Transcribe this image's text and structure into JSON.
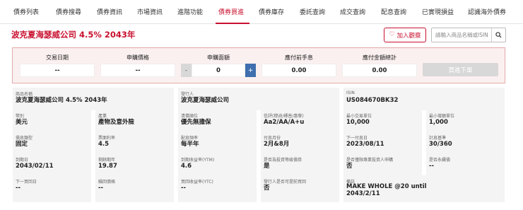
{
  "nav": {
    "items": [
      "債券列表",
      "債券搜尋",
      "債券資訊",
      "市場資訊",
      "進階功能",
      "債券買進",
      "債券庫存",
      "委託查詢",
      "成交查詢",
      "配息查詢",
      "已實現損益",
      "認識海外債券"
    ],
    "active": "債券買進"
  },
  "header": {
    "title": "波克夏海瑟威公司 4.5% 2043年",
    "favorite_label": "加入觀察",
    "search_placeholder": "請輸入商品名稱或ISIN"
  },
  "trade": {
    "trade_date_label": "交易日期",
    "trade_date_value": "--",
    "price_label": "申購價格",
    "price_value": "--",
    "face_label": "申購面額",
    "face_value": "0",
    "minus_label": "-",
    "plus_label": "+",
    "fee_label": "應付前手息",
    "fee_value": "0.00",
    "total_label": "應付金額總計",
    "total_value": "0.00",
    "submit_label": "買進下單"
  },
  "info": {
    "product_name": {
      "label": "商品名稱",
      "value": "波克夏海瑟威公司 4.5% 2043年"
    },
    "issuer": {
      "label": "發行人",
      "value": "波克夏海瑟威公司"
    },
    "isin": {
      "label": "ISIN",
      "value": "US084670BK32"
    },
    "currency": {
      "label": "幣別",
      "value": "美元"
    },
    "industry": {
      "label": "產業",
      "value": "產物及意外險"
    },
    "seniority": {
      "label": "清償順位",
      "value": "優先無擔保"
    },
    "rating": {
      "label": "信評(穆迪/標普/惠譽)",
      "value": "Aa2/AA/A+u"
    },
    "min_unit": {
      "label": "最小交易單位",
      "value": "10,000"
    },
    "min_increment": {
      "label": "最小增額單位",
      "value": "1,000"
    },
    "bond_type": {
      "label": "債息類型",
      "value": "固定"
    },
    "coupon_rate": {
      "label": "票面利率",
      "value": "4.5"
    },
    "pay_freq": {
      "label": "配息頻率",
      "value": "每半年"
    },
    "pay_month": {
      "label": "付息月份",
      "value": "2月&8月"
    },
    "next_pay": {
      "label": "下一付息日",
      "value": "2023/08/11"
    },
    "day_count": {
      "label": "計息基準",
      "value": "30/360"
    },
    "maturity": {
      "label": "到期日",
      "value": "2043/02/11"
    },
    "remaining": {
      "label": "剩餘期年",
      "value": "19.87"
    },
    "ytm": {
      "label": "到期收益率(YTM)",
      "value": "4.6"
    },
    "inv_grade": {
      "label": "是否為投資等級債券",
      "value": "是"
    },
    "pro_only": {
      "label": "是否僅限專業投資人申購",
      "value": "否"
    },
    "perpetual": {
      "label": "是否永續債",
      "value": "--"
    },
    "next_call": {
      "label": "下一買回日",
      "value": "--"
    },
    "call_price": {
      "label": "贖回價格",
      "value": "--"
    },
    "ytc": {
      "label": "買回收益率(YTC)",
      "value": "--"
    },
    "early_call": {
      "label": "發行人是否可提前買回",
      "value": "否"
    },
    "remarks": {
      "label": "備註",
      "value": "MAKE WHOLE @20 until 2043/2/11"
    }
  }
}
